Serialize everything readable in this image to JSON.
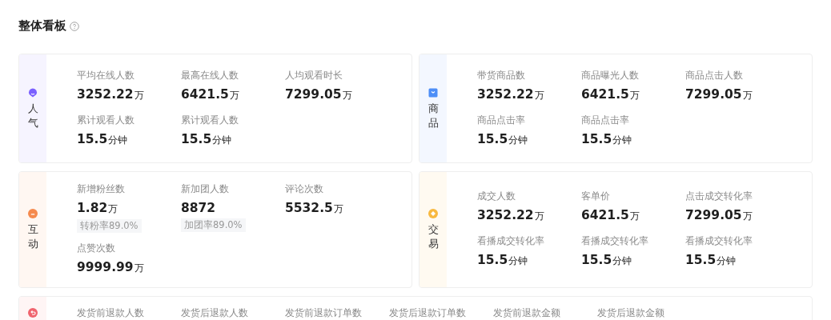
{
  "title": "整体看板",
  "rows": [
    [
      {
        "kind": "popularity",
        "label": "人气",
        "color": "#7b61ff",
        "metrics": [
          {
            "label": "平均在线人数",
            "value": "3252.22",
            "unit": "万"
          },
          {
            "label": "最高在线人数",
            "value": "6421.5",
            "unit": "万"
          },
          {
            "label": "人均观看时长",
            "value": "7299.05",
            "unit": "万"
          },
          {
            "label": "累计观看人数",
            "value": "15.5",
            "unit": "分钟"
          },
          {
            "label": "累计观看人数",
            "value": "15.5",
            "unit": "分钟"
          }
        ]
      },
      {
        "kind": "goods",
        "label": "商品",
        "color": "#4d8ef7",
        "metrics": [
          {
            "label": "带货商品数",
            "value": "3252.22",
            "unit": "万"
          },
          {
            "label": "商品曝光人数",
            "value": "6421.5",
            "unit": "万"
          },
          {
            "label": "商品点击人数",
            "value": "7299.05",
            "unit": "万"
          },
          {
            "label": "商品点击率",
            "value": "15.5",
            "unit": "分钟"
          },
          {
            "label": "商品点击率",
            "value": "15.5",
            "unit": "分钟"
          }
        ]
      }
    ],
    [
      {
        "kind": "interaction",
        "label": "互动",
        "color": "#f58a4e",
        "metrics": [
          {
            "label": "新增粉丝数",
            "value": "1.82",
            "unit": "万",
            "note": "转粉率89.0%"
          },
          {
            "label": "新加团人数",
            "value": "8872",
            "note": "加团率89.0%"
          },
          {
            "label": "评论次数",
            "value": "5532.5",
            "unit": "万"
          },
          {
            "label": "点赞次数",
            "value": "9999.99",
            "unit": "万"
          }
        ]
      },
      {
        "kind": "trade",
        "label": "交易",
        "color": "#f8b940",
        "metrics": [
          {
            "label": "成交人数",
            "value": "3252.22",
            "unit": "万"
          },
          {
            "label": "客单价",
            "value": "6421.5",
            "unit": "万"
          },
          {
            "label": "点击成交转化率",
            "value": "7299.05",
            "unit": "万"
          },
          {
            "label": "看播成交转化率",
            "value": "15.5",
            "unit": "分钟"
          },
          {
            "label": "看播成交转化率",
            "value": "15.5",
            "unit": "分钟"
          },
          {
            "label": "看播成交转化率",
            "value": "15.5",
            "unit": "分钟"
          }
        ]
      }
    ],
    [
      {
        "kind": "aftersale",
        "color": "#f0646e",
        "metrics": [
          {
            "label": "发货前退款人数"
          },
          {
            "label": "发货后退款人数"
          },
          {
            "label": "发货前退款订单数"
          },
          {
            "label": "发货后退款订单数"
          },
          {
            "label": "发货前退款金额"
          },
          {
            "label": "发货后退款金额"
          }
        ]
      }
    ]
  ]
}
